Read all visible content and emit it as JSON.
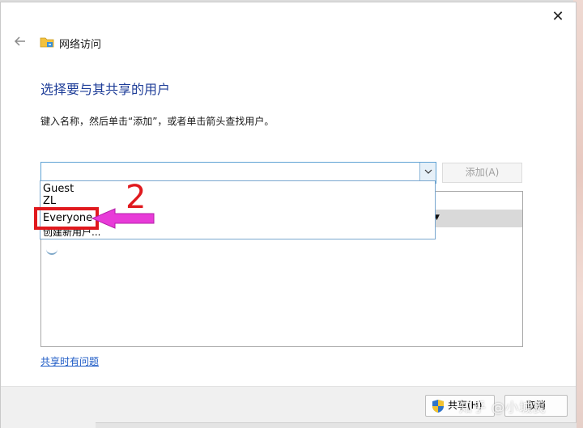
{
  "window": {
    "title": "网络访问",
    "close_glyph": "✕"
  },
  "main": {
    "heading": "选择要与其共享的用户",
    "instruction": "键入名称，然后单击“添加”，或者单击箭头查找用户。"
  },
  "user_picker": {
    "input_value": "",
    "add_label": "添加(A)",
    "options": [
      "Guest",
      "ZL",
      "Everyone",
      "创建新用户..."
    ]
  },
  "annotation": {
    "step_number": "2",
    "highlight_color": "#e0191e",
    "arrow_color": "#e83bd8"
  },
  "help_link": "共享时有问题",
  "footer": {
    "share_label": "共享(H)",
    "cancel_label": "取消"
  },
  "watermark": "知乎 @小城民",
  "icons": {
    "back": "arrow-left-icon",
    "folder": "network-folder-icon",
    "shield": "uac-shield-icon",
    "close": "close-icon"
  },
  "colors": {
    "heading": "#1e3d98",
    "link": "#1e5bc6",
    "focus_border": "#5fa2d4"
  }
}
